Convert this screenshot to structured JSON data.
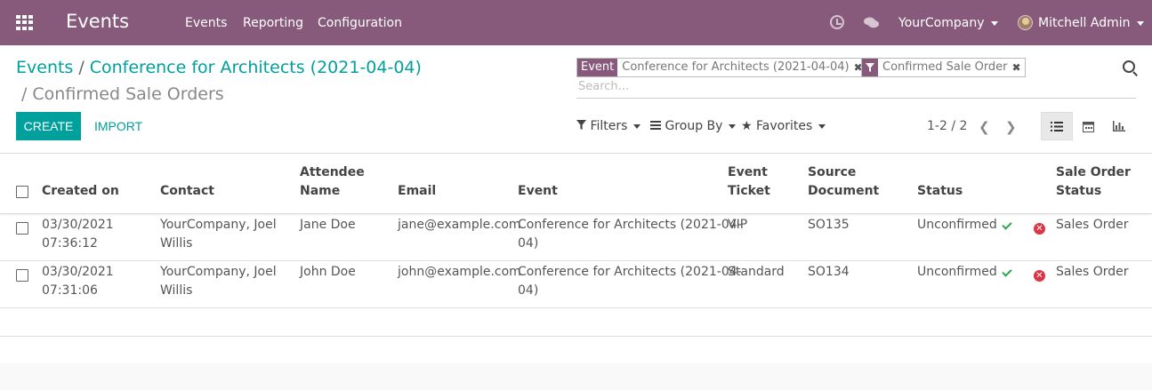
{
  "navbar": {
    "app_title": "Events",
    "menu": [
      "Events",
      "Reporting",
      "Configuration"
    ],
    "company": "YourCompany",
    "user": "Mitchell Admin",
    "bg_color": "#875a7b"
  },
  "breadcrumb": {
    "root": "Events",
    "event": "Conference for Architects (2021-04-04)",
    "current": "Confirmed Sale Orders"
  },
  "buttons": {
    "create": "CREATE",
    "import": "IMPORT"
  },
  "search": {
    "facets": [
      {
        "tag": "Event",
        "value": "Conference for Architects (2021-04-04)"
      },
      {
        "tag": "filter-icon",
        "value": "Confirmed Sale Order"
      }
    ],
    "placeholder": "Search..."
  },
  "controls": {
    "filters": "Filters",
    "group_by": "Group By",
    "favorites": "Favorites"
  },
  "pager": {
    "value": "1-2 / 2"
  },
  "table": {
    "headers": {
      "created_on": "Created on",
      "contact": "Contact",
      "attendee_name": [
        "Attendee",
        "Name"
      ],
      "email": "Email",
      "event": "Event",
      "event_ticket": [
        "Event",
        "Ticket"
      ],
      "source_document": [
        "Source",
        "Document"
      ],
      "status": "Status",
      "sale_order_status": [
        "Sale Order",
        "Status"
      ]
    },
    "rows": [
      {
        "created_on": [
          "03/30/2021",
          "07:36:12"
        ],
        "contact": [
          "YourCompany, Joel",
          "Willis"
        ],
        "attendee_name": "Jane Doe",
        "email": "jane@example.com",
        "event": [
          "Conference for Architects (2021-04-",
          "04)"
        ],
        "event_ticket": "VIP",
        "source_document": "SO135",
        "status": "Unconfirmed",
        "sale_order_status": "Sales Order"
      },
      {
        "created_on": [
          "03/30/2021",
          "07:31:06"
        ],
        "contact": [
          "YourCompany, Joel",
          "Willis"
        ],
        "attendee_name": "John Doe",
        "email": "john@example.com",
        "event": [
          "Conference for Architects (2021-04-",
          "04)"
        ],
        "event_ticket": "Standard",
        "source_document": "SO134",
        "status": "Unconfirmed",
        "sale_order_status": "Sales Order"
      }
    ]
  }
}
